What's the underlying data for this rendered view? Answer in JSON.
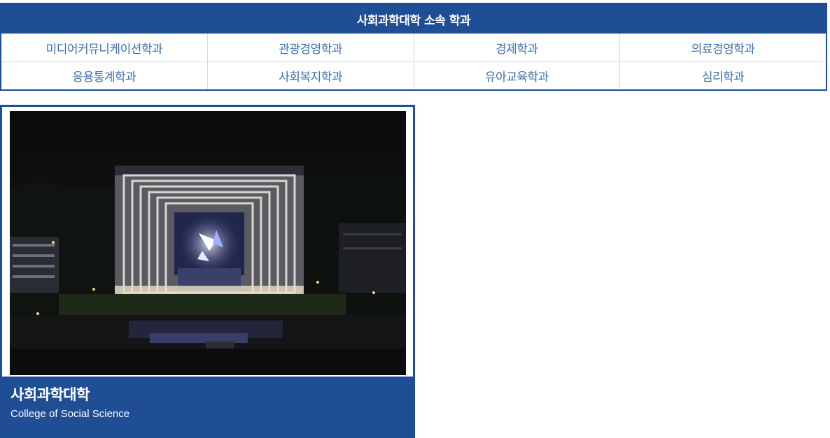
{
  "departments": {
    "header": "사회과학대학 소속 학과",
    "rows": [
      [
        "미디어커뮤니케이션학과",
        "관광경영학과",
        "경제학과",
        "의료경영학과"
      ],
      [
        "응용통계학과",
        "사회복지학과",
        "유아교육학과",
        "심리학과"
      ]
    ]
  },
  "college": {
    "title": "사회과학대학",
    "subtitle": "College of Social Science",
    "photo_icon": "building-night-photo"
  },
  "colors": {
    "brand": "#1f4e94",
    "link": "#3f6fa8",
    "divider": "#d6dbe3"
  }
}
